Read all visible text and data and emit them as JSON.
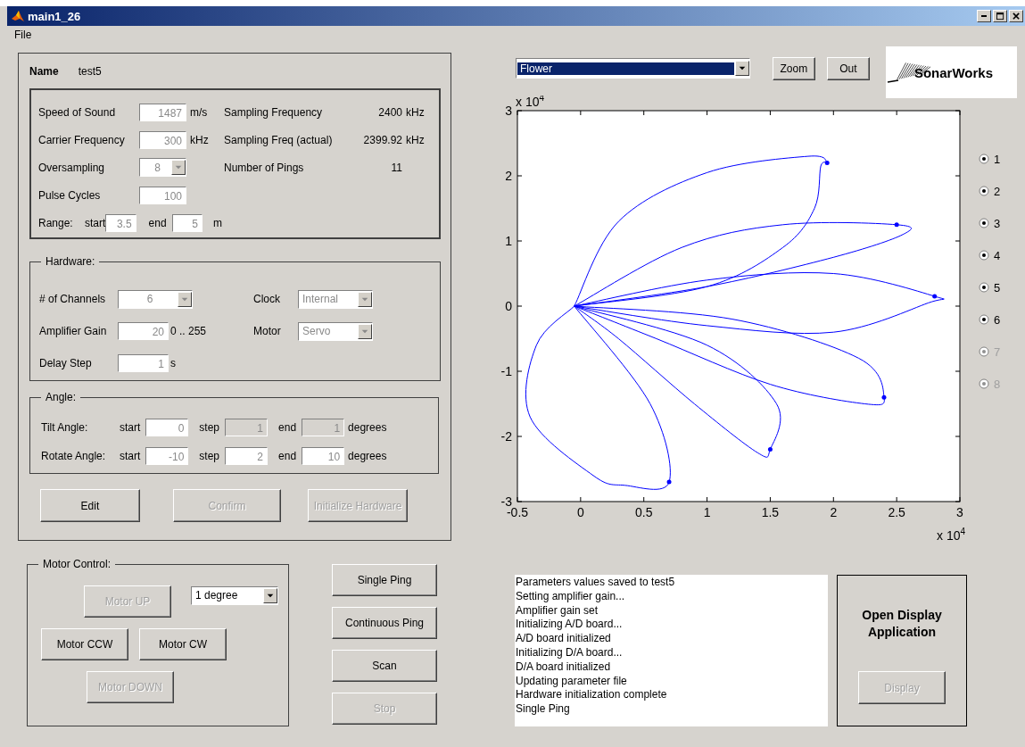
{
  "window": {
    "title": "main1_26"
  },
  "menu": [
    "File"
  ],
  "name": {
    "label": "Name",
    "value": "test5"
  },
  "parameters": {
    "left": [
      {
        "label": "Speed of Sound",
        "value": "1487",
        "unit": "m/s",
        "kind": "field"
      },
      {
        "label": "Carrier Frequency",
        "value": "300",
        "unit": "kHz",
        "kind": "field"
      },
      {
        "label": "Oversampling",
        "value": "8",
        "kind": "dropdown"
      },
      {
        "label": "Pulse Cycles",
        "value": "100",
        "kind": "field"
      }
    ],
    "range": {
      "label": "Range:",
      "start_label": "start",
      "start": "3.5",
      "end_label": "end",
      "end": "5",
      "unit": "m"
    },
    "right": [
      {
        "label": "Sampling Frequency",
        "value": "2400",
        "unit": "kHz"
      },
      {
        "label": "Sampling Freq (actual)",
        "value": "2399.92",
        "unit": "kHz"
      },
      {
        "label": "Number of Pings",
        "value": "11"
      }
    ]
  },
  "hardware": {
    "title": "Hardware:",
    "left": [
      {
        "label": "# of Channels",
        "value": "6",
        "kind": "dropdown"
      },
      {
        "label": "Amplifier Gain",
        "value": "20",
        "kind": "field",
        "unit": "0 .. 255"
      },
      {
        "label": "Delay Step",
        "value": "1",
        "kind": "field",
        "unit": "s"
      }
    ],
    "right": [
      {
        "label": "Clock",
        "value": "Internal",
        "kind": "dropdown"
      },
      {
        "label": "Motor",
        "value": "Servo",
        "kind": "dropdown"
      }
    ]
  },
  "angle": {
    "title": "Angle:",
    "rows": [
      {
        "label": "Tilt Angle:",
        "unit": "degrees",
        "fields": [
          {
            "label": "start",
            "value": "0",
            "disabled": false
          },
          {
            "label": "step",
            "value": "1",
            "disabled": true
          },
          {
            "label": "end",
            "value": "1",
            "disabled": true
          }
        ]
      },
      {
        "label": "Rotate Angle:",
        "unit": "degrees",
        "fields": [
          {
            "label": "start",
            "value": "-10",
            "disabled": false
          },
          {
            "label": "step",
            "value": "2",
            "disabled": false
          },
          {
            "label": "end",
            "value": "10",
            "disabled": false
          }
        ]
      }
    ]
  },
  "setup_buttons": [
    {
      "label": "Edit",
      "disabled": false
    },
    {
      "label": "Confirm",
      "disabled": true
    },
    {
      "label": "Initialize Hardware",
      "disabled": true
    }
  ],
  "motor_control": {
    "title": "Motor Control:",
    "step": "1 degree",
    "buttons": [
      {
        "label": "Motor UP",
        "disabled": true
      },
      {
        "label": "Motor CCW",
        "disabled": false
      },
      {
        "label": "Motor CW",
        "disabled": false
      },
      {
        "label": "Motor DOWN",
        "disabled": true
      }
    ]
  },
  "ping_buttons": [
    {
      "label": "Single Ping",
      "disabled": false
    },
    {
      "label": "Continuous Ping",
      "disabled": false
    },
    {
      "label": "Scan",
      "disabled": false
    },
    {
      "label": "Stop",
      "disabled": true
    }
  ],
  "plot_controls": {
    "view": "Flower",
    "buttons": [
      "Zoom",
      "Out"
    ]
  },
  "logo": "SonarWorks",
  "plot": {
    "y_multiplier": {
      "base": "x 10",
      "exponent": "4"
    },
    "x_multiplier": {
      "base": "x 10",
      "exponent": "4"
    },
    "x_ticks": [
      "-0.5",
      "0",
      "0.5",
      "1",
      "1.5",
      "2",
      "2.5",
      "3"
    ],
    "y_ticks": [
      "3",
      "2",
      "1",
      "0",
      "-1",
      "-2",
      "-3"
    ]
  },
  "channels": [
    {
      "label": "1",
      "selected": true,
      "disabled": false
    },
    {
      "label": "2",
      "selected": true,
      "disabled": false
    },
    {
      "label": "3",
      "selected": true,
      "disabled": false
    },
    {
      "label": "4",
      "selected": true,
      "disabled": false
    },
    {
      "label": "5",
      "selected": true,
      "disabled": false
    },
    {
      "label": "6",
      "selected": true,
      "disabled": false
    },
    {
      "label": "7",
      "selected": true,
      "disabled": true
    },
    {
      "label": "8",
      "selected": true,
      "disabled": true
    }
  ],
  "log": [
    "Parameters values saved to test5",
    "Setting amplifier gain...",
    "Amplifier gain set",
    "Initializing A/D board...",
    "A/D board initialized",
    "Initializing D/A board...",
    "D/A board initialized",
    "Updating parameter file",
    "Hardware initialization complete",
    "Single Ping"
  ],
  "display_panel": {
    "title": "Open Display Application",
    "button": {
      "label": "Display",
      "disabled": true
    }
  }
}
